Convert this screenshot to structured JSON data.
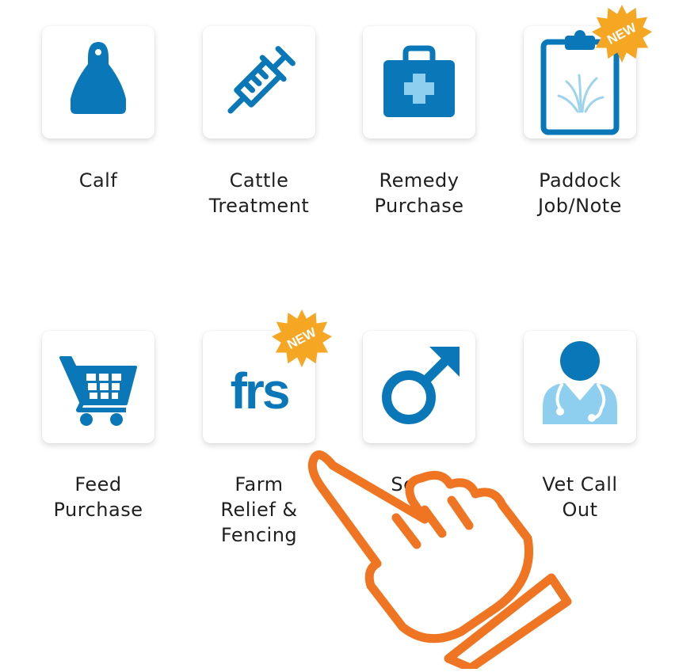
{
  "menu": {
    "items": [
      {
        "label_lines": [
          "Calf"
        ],
        "icon": "ear-tag-icon"
      },
      {
        "label_lines": [
          "Cattle",
          "Treatment"
        ],
        "icon": "syringe-icon"
      },
      {
        "label_lines": [
          "Remedy",
          "Purchase"
        ],
        "icon": "medical-kit-icon"
      },
      {
        "label_lines": [
          "Paddock",
          "Job/Note"
        ],
        "icon": "clipboard-grass-icon",
        "badge": "NEW"
      },
      {
        "label_lines": [
          "Feed",
          "Purchase"
        ],
        "icon": "shopping-cart-icon"
      },
      {
        "label_lines": [
          "Farm",
          "Relief &",
          "Fencing"
        ],
        "icon": "frs-logo-icon",
        "icon_text": "frs",
        "badge": "NEW"
      },
      {
        "label_lines": [
          "Serve"
        ],
        "icon": "male-symbol-icon"
      },
      {
        "label_lines": [
          "Vet Call",
          "Out"
        ],
        "icon": "doctor-stethoscope-icon"
      }
    ]
  },
  "colors": {
    "icon_blue": "#0a78b8",
    "icon_light_blue": "#8ecff0",
    "badge_yellow": "#f5a623",
    "pointer_orange": "#f07522"
  },
  "overlay": {
    "icon": "pointing-hand-icon"
  }
}
